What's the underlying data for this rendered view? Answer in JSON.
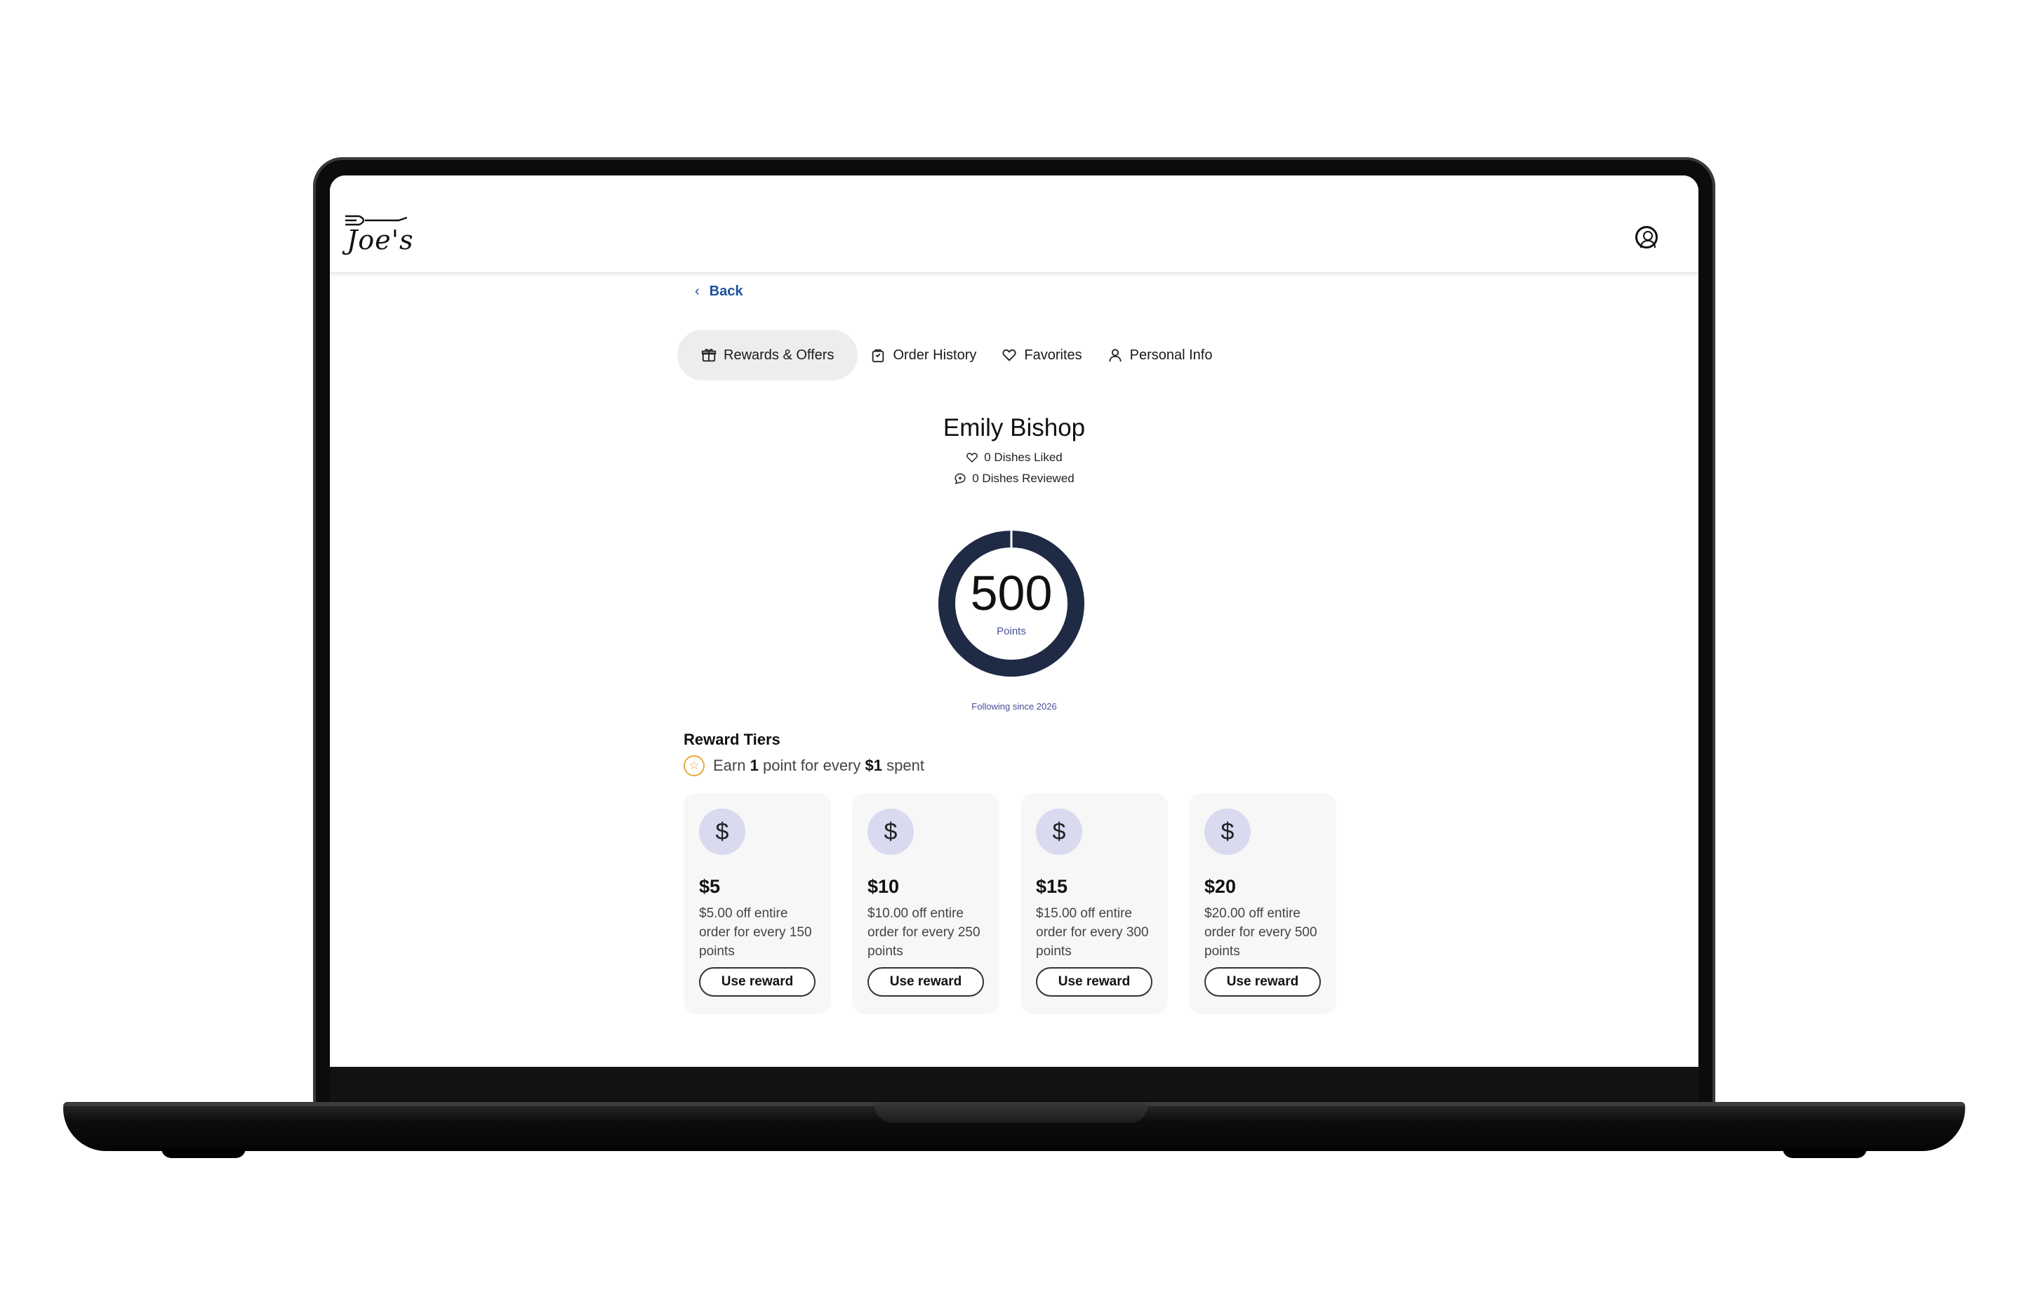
{
  "app": {
    "logo_text": "Joe's"
  },
  "nav": {
    "back_label": "Back"
  },
  "tabs": [
    {
      "label": "Rewards & Offers",
      "icon": "gift-icon",
      "active": true
    },
    {
      "label": "Order History",
      "icon": "bag-icon",
      "active": false
    },
    {
      "label": "Favorites",
      "icon": "heart-icon",
      "active": false
    },
    {
      "label": "Personal Info",
      "icon": "person-icon",
      "active": false
    }
  ],
  "profile": {
    "name": "Emily Bishop",
    "dishes_liked": "0 Dishes Liked",
    "dishes_reviewed": "0 Dishes Reviewed",
    "points": "500",
    "points_label": "Points",
    "following_since": "Following since 2026"
  },
  "rewards": {
    "title": "Reward Tiers",
    "earn_prefix": "Earn",
    "earn_points": "1",
    "earn_middle": "point for every",
    "earn_amount": "$1",
    "earn_suffix": "spent",
    "tiers": [
      {
        "amount": "$5",
        "description": "$5.00 off entire order for every 150 points",
        "button": "Use reward"
      },
      {
        "amount": "$10",
        "description": "$10.00 off entire order for every 250 points",
        "button": "Use reward"
      },
      {
        "amount": "$15",
        "description": "$15.00 off entire order for every 300 points",
        "button": "Use reward"
      },
      {
        "amount": "$20",
        "description": "$20.00 off entire order for every 500 points",
        "button": "Use reward"
      }
    ]
  },
  "colors": {
    "accent_link": "#1e4fa0",
    "ring": "#1f2b45",
    "muted_purple": "#4a4f9a",
    "icon_bg": "#d9d9f0",
    "star": "#e8a93a"
  }
}
